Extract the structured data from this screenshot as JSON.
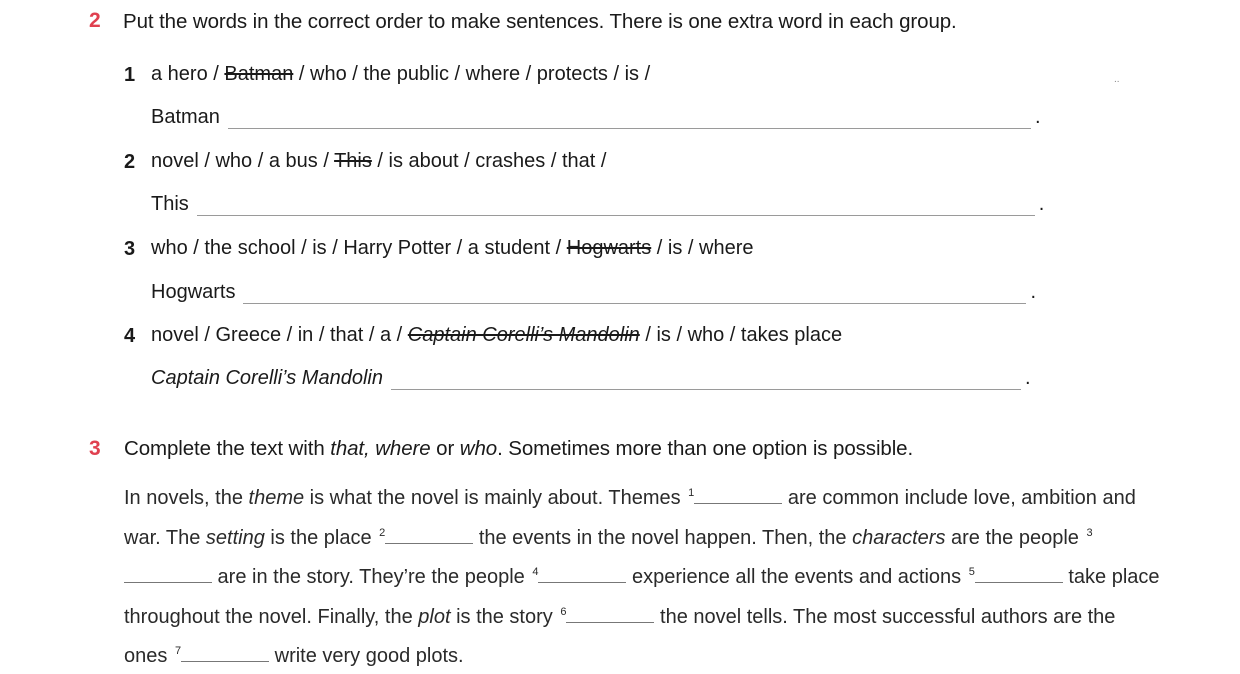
{
  "ex2": {
    "number": "2",
    "instruction": "Put the words in the correct order to make sentences. There is one extra word in each group.",
    "items": [
      {
        "n": "1",
        "parts": [
          "a hero / ",
          "Batman",
          " / who / the public / where / protects / is /"
        ],
        "starter": "Batman"
      },
      {
        "n": "2",
        "parts": [
          "novel / who / a bus / ",
          "This",
          " / is about / crashes / that /"
        ],
        "starter": "This"
      },
      {
        "n": "3",
        "parts": [
          "who / the school / is / Harry Potter / a student / ",
          "Hogwarts",
          " / is / where"
        ],
        "starter": "Hogwarts"
      },
      {
        "n": "4",
        "parts": [
          "novel / Greece / in / that / a / ",
          "Captain Corelli’s Mandolin",
          " / is / who / takes place"
        ],
        "starter": "Captain Corelli’s Mandolin"
      }
    ],
    "end_dot": "."
  },
  "ex3": {
    "number": "3",
    "instruction_a": "Complete the text with ",
    "instruction_i1": "that, where",
    "instruction_b": " or ",
    "instruction_i2": "who",
    "instruction_c": ". Sometimes more than one option is possible.",
    "text": {
      "t1": "In novels, the ",
      "i_theme": "theme",
      "t2": " is what the novel is mainly about. Themes ",
      "s1": "1",
      "t3": " are common include love, ambition and war. The ",
      "i_setting": "setting",
      "t4": " is the place ",
      "s2": "2",
      "t5": " the events in the novel happen. Then, the ",
      "i_characters": "characters",
      "t6": " are the people ",
      "s3": "3",
      "t7": " are in the story. They’re the people ",
      "s4": "4",
      "t8": " experience all the events and actions ",
      "s5": "5",
      "t9": " take place throughout the novel. Finally, the ",
      "i_plot": "plot",
      "t10": " is the story ",
      "s6": "6",
      "t11": " the novel tells. The most successful authors are the ones ",
      "s7": "7",
      "t12": " write very good plots."
    }
  },
  "stray_mark": ".."
}
